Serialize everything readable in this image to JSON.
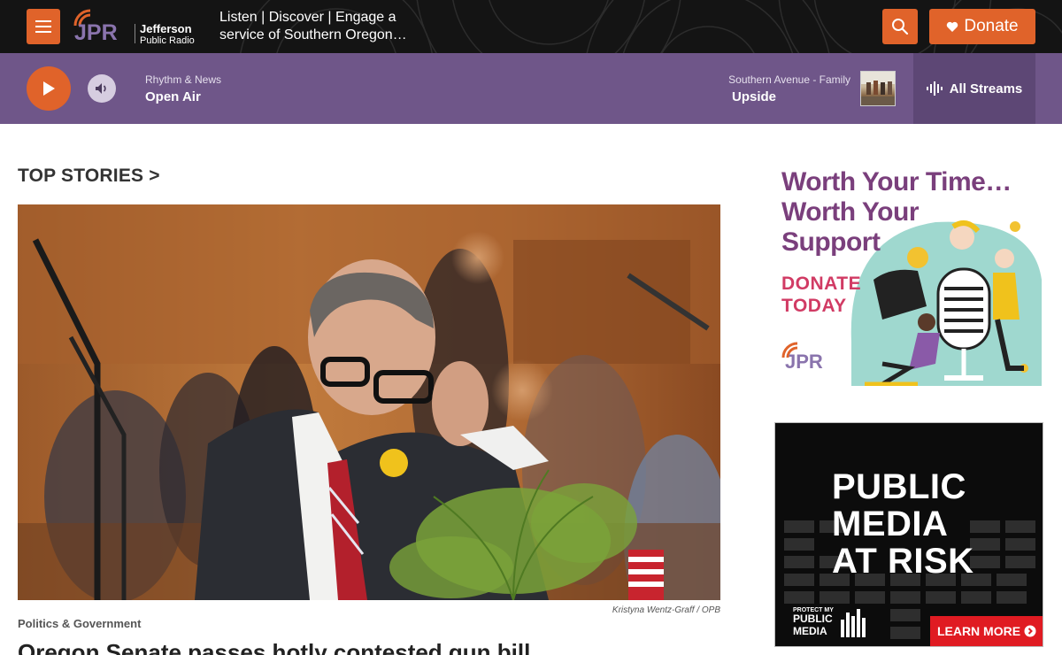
{
  "header": {
    "logo_text": "JPR",
    "logo_name_line1": "Jefferson",
    "logo_name_line2": "Public Radio",
    "tagline": "Listen | Discover | Engage a service of Southern Oregon…",
    "donate_label": "Donate",
    "menu_icon": "hamburger-icon",
    "search_icon": "search-icon",
    "donate_icon": "heart-icon"
  },
  "player": {
    "now_label": "Rhythm & News",
    "now_title": "Open Air",
    "next_label": "Southern Avenue - Family",
    "next_title": "Upside",
    "streams_label": "All Streams"
  },
  "main": {
    "section_title": "TOP STORIES >",
    "photo_credit": "Kristyna Wentz-Graff  /  OPB",
    "category": "Politics & Government",
    "headline": "Oregon Senate passes hotly contested gun bill"
  },
  "ads": {
    "ad1": {
      "line1": "Worth Your Time…",
      "line2": "Worth Your",
      "line3": "Support",
      "donate1": "DONATE",
      "donate2": "TODAY",
      "logo": "JPR"
    },
    "ad2": {
      "line1": "PUBLIC",
      "line2": "MEDIA",
      "line3": "AT RISK",
      "small1": "PROTECT MY",
      "small2": "PUBLIC",
      "small3": "MEDIA",
      "learn_more": "LEARN MORE"
    }
  },
  "colors": {
    "accent": "#e0632a",
    "player_bg": "#6f5689",
    "header_bg": "#141414"
  }
}
